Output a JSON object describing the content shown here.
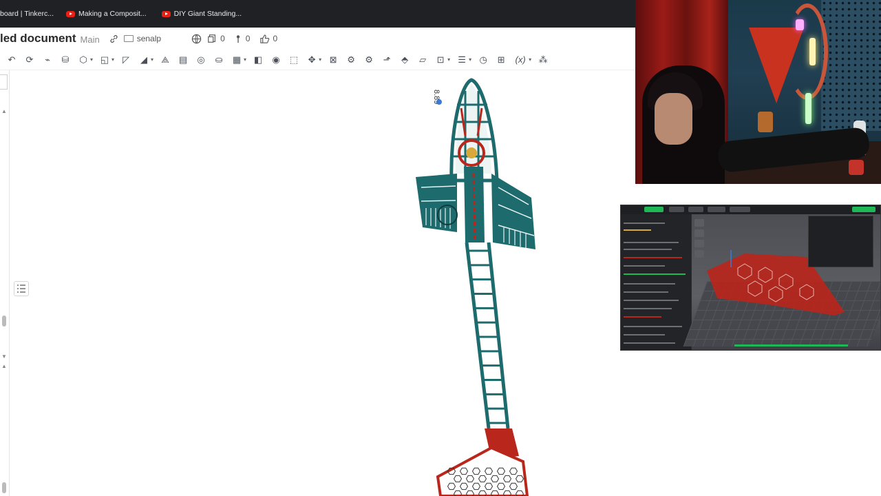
{
  "bookmarks": [
    {
      "label": "board | Tinkerc...",
      "icon": "none"
    },
    {
      "label": "Making a Composit...",
      "icon": "youtube-icon"
    },
    {
      "label": "DIY Giant Standing...",
      "icon": "youtube-icon"
    }
  ],
  "document": {
    "title": "led document",
    "branch": "Main",
    "owner": "senalp",
    "versions_count": "0",
    "releases_count": "0",
    "likes_count": "0"
  },
  "model": {
    "dimension_label": "8.89",
    "colors": {
      "frame": "#1e6b6e",
      "accent": "#b8261c",
      "background": "#ffffff"
    }
  },
  "overlays": {
    "webcam": "webcam-feed",
    "slicer": "slicer-window"
  }
}
